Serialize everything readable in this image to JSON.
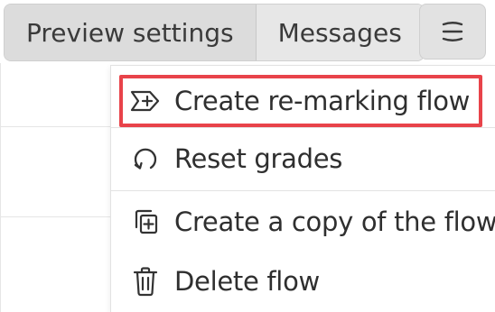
{
  "toolbar": {
    "tabs": [
      {
        "label": "Preview settings"
      },
      {
        "label": "Messages"
      }
    ],
    "menu_icon": "hamburger-menu-icon"
  },
  "dropdown": {
    "items": [
      {
        "label": "Create re-marking flow",
        "icon": "flow-plus-icon",
        "highlighted": true
      },
      {
        "label": "Reset grades",
        "icon": "reset-icon"
      },
      {
        "label": "Create a copy of the flow",
        "icon": "copy-plus-icon"
      },
      {
        "label": "Delete flow",
        "icon": "trash-icon"
      }
    ]
  },
  "colors": {
    "highlight": "#e8434a",
    "button_bg": "#e2e2e2",
    "text": "#2f2f2f"
  }
}
